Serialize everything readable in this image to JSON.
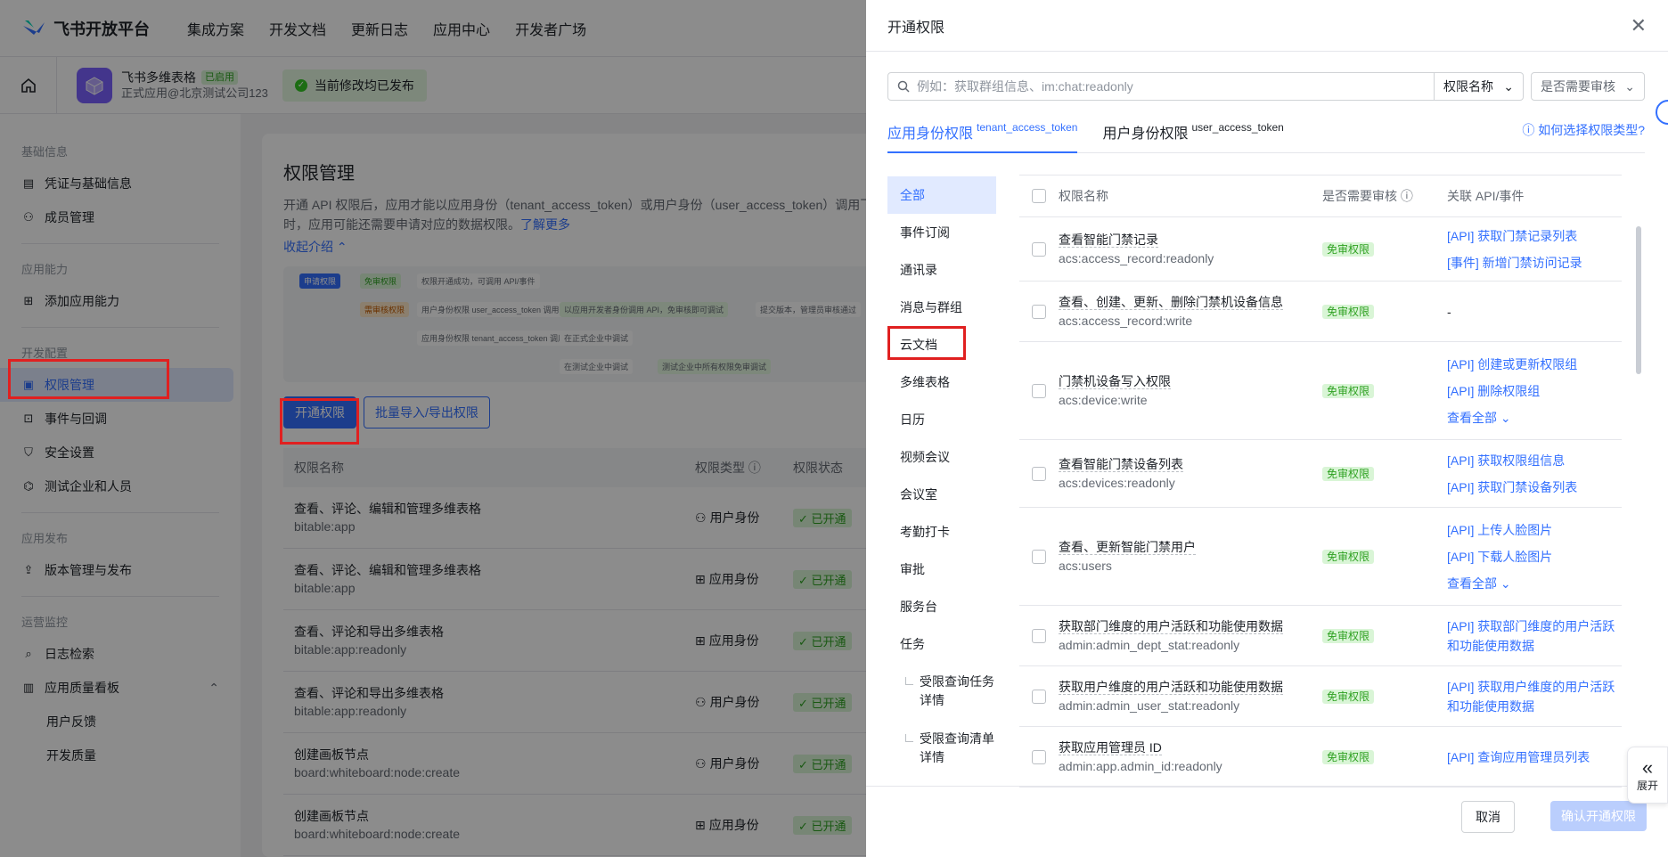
{
  "topnav": {
    "brand": "飞书开放平台",
    "items": [
      "集成方案",
      "开发文档",
      "更新日志",
      "应用中心",
      "开发者广场"
    ]
  },
  "appbar": {
    "app_name": "飞书多维表格",
    "app_tag": "已启用",
    "app_sub": "正式应用@北京测试公司123",
    "published": "当前修改均已发布"
  },
  "sidebar": {
    "groups": [
      "基础信息",
      "应用能力",
      "开发配置",
      "应用发布",
      "运营监控"
    ],
    "items": [
      "凭证与基础信息",
      "成员管理",
      "添加应用能力",
      "权限管理",
      "事件与回调",
      "安全设置",
      "测试企业和人员",
      "版本管理与发布",
      "日志检索",
      "应用质量看板",
      "用户反馈",
      "开发质量"
    ]
  },
  "main": {
    "title": "权限管理",
    "desc": "开通 API 权限后，应用才能以应用身份（tenant_access_token）或用户身份（user_access_token）调用飞书 API 时，应用可能还需要申请对应的数据权限。",
    "learn_more": "了解更多",
    "collapse": "收起介绍",
    "flow": [
      "申请权限",
      "免审权限",
      "权限开通成功，可调用 API/事件",
      "需审核权限",
      "用户身份权限 user_access_token 调用",
      "以应用开发者身份调用 API，免审核即可调试",
      "提交版本，管理员审核通过",
      "应用身份权限 tenant_access_token 调用",
      "在正式企业中调试",
      "在测试企业中调试",
      "测试企业中所有权限免审调试"
    ],
    "btn_open": "开通权限",
    "btn_batch": "批量导入/导出权限",
    "headers": [
      "权限名称",
      "权限类型",
      "权限状态"
    ],
    "rows": [
      {
        "name": "查看、评论、编辑和管理多维表格",
        "code": "bitable:app",
        "type": "用户身份",
        "status": "已开通"
      },
      {
        "name": "查看、评论、编辑和管理多维表格",
        "code": "bitable:app",
        "type": "应用身份",
        "status": "已开通"
      },
      {
        "name": "查看、评论和导出多维表格",
        "code": "bitable:app:readonly",
        "type": "应用身份",
        "status": "已开通"
      },
      {
        "name": "查看、评论和导出多维表格",
        "code": "bitable:app:readonly",
        "type": "用户身份",
        "status": "已开通"
      },
      {
        "name": "创建画板节点",
        "code": "board:whiteboard:node:create",
        "type": "用户身份",
        "status": "已开通"
      },
      {
        "name": "创建画板节点",
        "code": "board:whiteboard:node:create",
        "type": "应用身份",
        "status": "已开通"
      }
    ]
  },
  "drawer": {
    "title": "开通权限",
    "search_placeholder": "例如：获取群组信息、im:chat:readonly",
    "select1": "权限名称",
    "select2": "是否需要审核",
    "tab1": "应用身份权限",
    "tab1_sub": "tenant_access_token",
    "tab2": "用户身份权限",
    "tab2_sub": "user_access_token",
    "help": "如何选择权限类型?",
    "categories": [
      "全部",
      "事件订阅",
      "通讯录",
      "消息与群组",
      "云文档",
      "多维表格",
      "日历",
      "视频会议",
      "会议室",
      "考勤打卡",
      "审批",
      "服务台",
      "任务",
      "受限查询任务详情",
      "受限查询清单详情"
    ],
    "headers": [
      "权限名称",
      "是否需要审核",
      "关联 API/事件"
    ],
    "free": "免审权限",
    "rows": [
      {
        "name": "查看智能门禁记录",
        "code": "acs:access_record:readonly",
        "apis": [
          "[API] 获取门禁记录列表",
          "[事件] 新增门禁访问记录"
        ]
      },
      {
        "name": "查看、创建、更新、删除门禁机设备信息",
        "code": "acs:access_record:write",
        "apis": [
          "-"
        ]
      },
      {
        "name": "门禁机设备写入权限",
        "code": "acs:device:write",
        "apis": [
          "[API] 创建或更新权限组",
          "[API] 删除权限组",
          "查看全部"
        ]
      },
      {
        "name": "查看智能门禁设备列表",
        "code": "acs:devices:readonly",
        "apis": [
          "[API] 获取权限组信息",
          "[API] 获取门禁设备列表"
        ]
      },
      {
        "name": "查看、更新智能门禁用户",
        "code": "acs:users",
        "apis": [
          "[API] 上传人脸图片",
          "[API] 下载人脸图片",
          "查看全部"
        ]
      },
      {
        "name": "获取部门维度的用户活跃和功能使用数据",
        "code": "admin:admin_dept_stat:readonly",
        "apis": [
          "[API] 获取部门维度的用户活跃和功能使用数据"
        ]
      },
      {
        "name": "获取用户维度的用户活跃和功能使用数据",
        "code": "admin:admin_user_stat:readonly",
        "apis": [
          "[API] 获取用户维度的用户活跃和功能使用数据"
        ]
      },
      {
        "name": "获取应用管理员 ID",
        "code": "admin:app.admin_id:readonly",
        "apis": [
          "[API] 查询应用管理员列表"
        ]
      }
    ],
    "cancel": "取消",
    "confirm": "确认开通权限"
  },
  "expand_label": "展开"
}
